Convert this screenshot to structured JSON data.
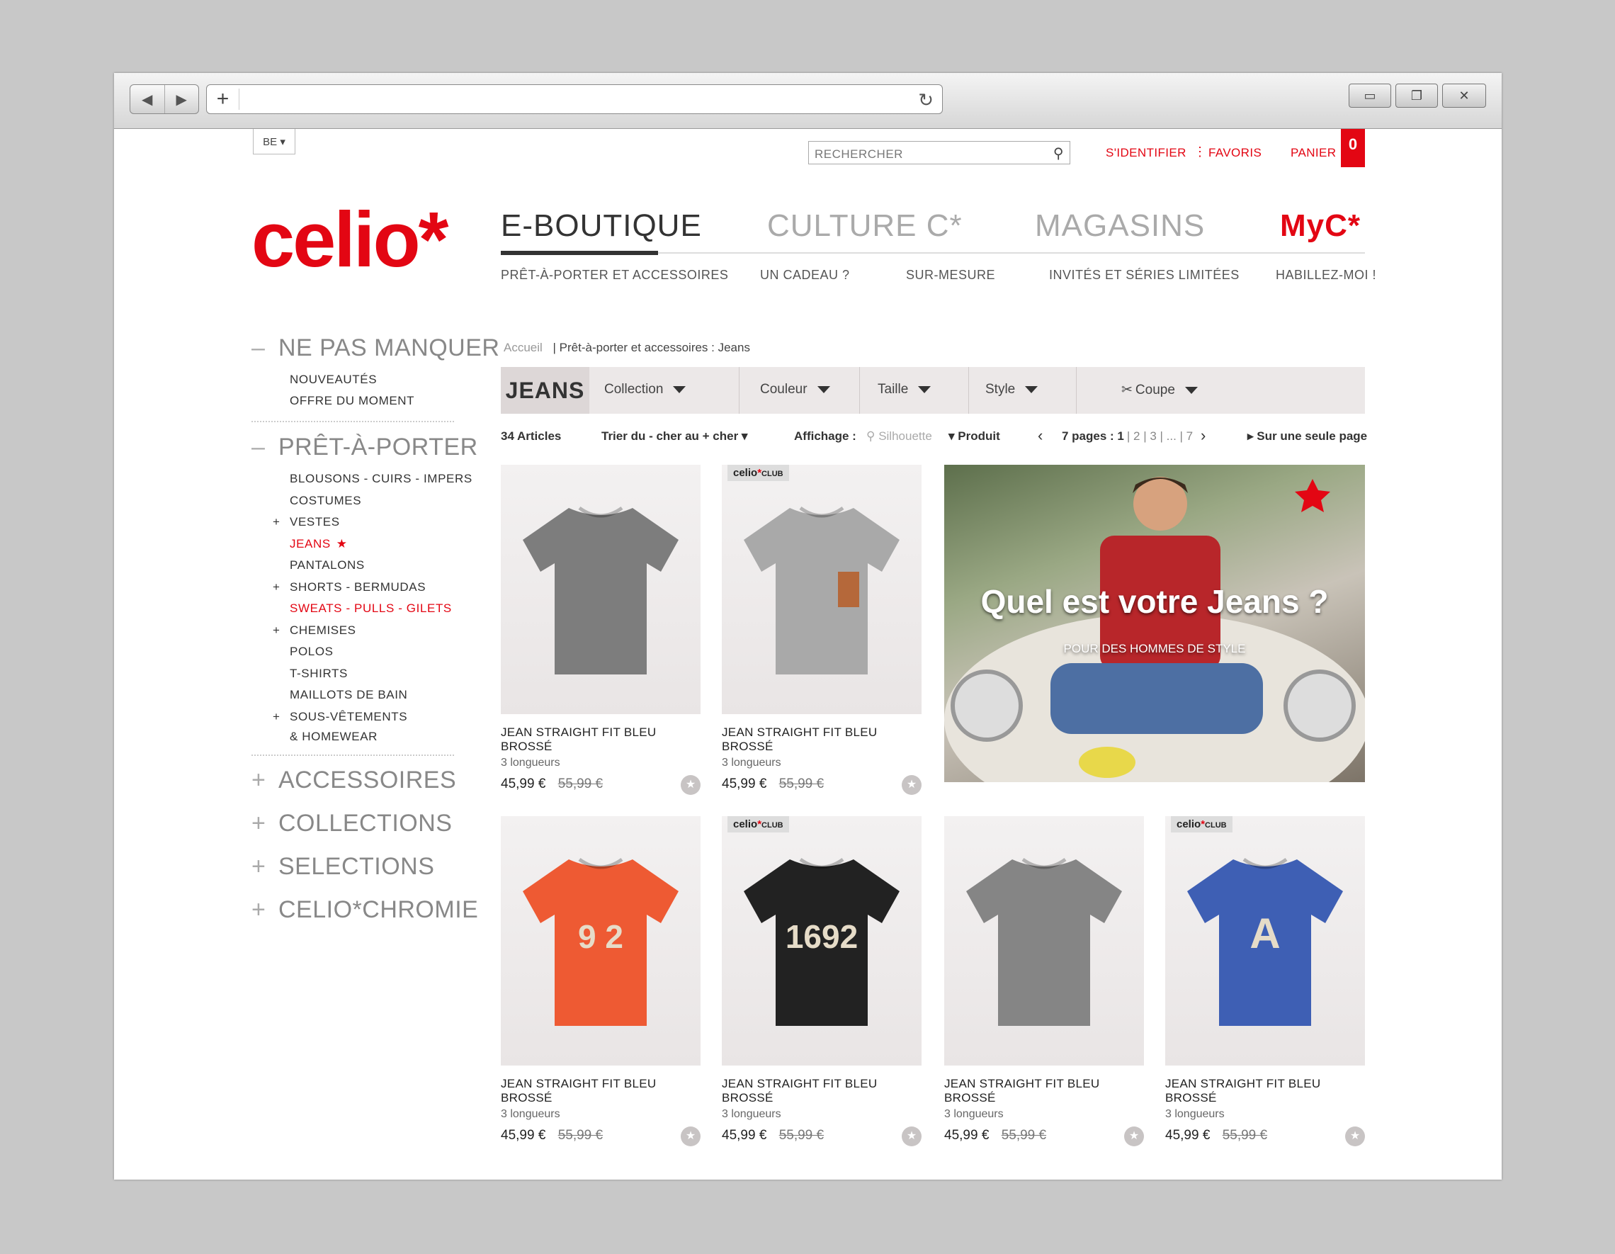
{
  "browser": {
    "back": "◀",
    "forward": "▶",
    "new_tab": "+",
    "reload": "↻",
    "minimize": "▭",
    "restore": "❐",
    "close": "✕"
  },
  "top": {
    "lang": "BE ▾",
    "search_placeholder": "RECHERCHER",
    "login": "S'IDENTIFIER",
    "favorites": "FAVORIS",
    "cart": "PANIER",
    "cart_count": "0"
  },
  "logo": "celio*",
  "main_nav": [
    {
      "label": "E-BOUTIQUE"
    },
    {
      "label": "CULTURE C*"
    },
    {
      "label": "MAGASINS"
    },
    {
      "label": "MyC*"
    }
  ],
  "sub_nav": [
    {
      "label": "PRÊT-À-PORTER ET ACCESSOIRES"
    },
    {
      "label": "UN CADEAU ?"
    },
    {
      "label": "SUR-MESURE"
    },
    {
      "label": "INVITÉS ET SÉRIES LIMITÉES"
    },
    {
      "label": "HABILLEZ-MOI !"
    }
  ],
  "sidebar": {
    "ne_pas_manquer": {
      "sign": "–",
      "label": "NE PAS MANQUER",
      "items": [
        "NOUVEAUTÉS",
        "OFFRE DU MOMENT"
      ]
    },
    "pret": {
      "sign": "–",
      "label": "PRÊT-À-PORTER",
      "items": [
        {
          "label": "BLOUSONS - CUIRS - IMPERS",
          "plus": ""
        },
        {
          "label": "COSTUMES",
          "plus": ""
        },
        {
          "label": "VESTES",
          "plus": "+"
        },
        {
          "label": "JEANS",
          "plus": "",
          "star": "★"
        },
        {
          "label": "PANTALONS",
          "plus": ""
        },
        {
          "label": "SHORTS - BERMUDAS",
          "plus": "+"
        },
        {
          "label": "SWEATS - PULLS - GILETS",
          "plus": ""
        },
        {
          "label": "CHEMISES",
          "plus": "+"
        },
        {
          "label": "POLOS",
          "plus": ""
        },
        {
          "label": "T-SHIRTS",
          "plus": ""
        },
        {
          "label": "MAILLOTS DE BAIN",
          "plus": ""
        },
        {
          "label": "SOUS-VÊTEMENTS",
          "plus": "+"
        },
        {
          "label": "& HOMEWEAR",
          "plus": ""
        }
      ]
    },
    "sections": [
      {
        "sign": "+",
        "label": "ACCESSOIRES"
      },
      {
        "sign": "+",
        "label": "COLLECTIONS"
      },
      {
        "sign": "+",
        "label": "SELECTIONS"
      },
      {
        "sign": "+",
        "label": "CELIO*CHROMIE"
      }
    ]
  },
  "breadcrumb": {
    "home": "Accueil",
    "path": "| Prêt-à-porter et accessoires : Jeans"
  },
  "filters": {
    "title": "JEANS",
    "collection": "Collection",
    "couleur": "Couleur",
    "taille": "Taille",
    "style": "Style",
    "coupe": "Coupe"
  },
  "toolbar": {
    "count": "34 Articles",
    "sort": "Trier du - cher au + cher ▾",
    "display_label": "Affichage :",
    "silhouette": "Silhouette",
    "produit": "Produit",
    "pages_label": "7 pages : 1",
    "pages_rest": "| 2 | 3 | ... | 7",
    "single": "▸ Sur une seule page"
  },
  "hero": {
    "title": "Quel est votre Jeans ?",
    "subtitle": "POUR DES HOMMES DE STYLE"
  },
  "club_badge": {
    "brand": "celio",
    "star": "*",
    "club": "CLUB"
  },
  "products": [
    {
      "name": "JEAN STRAIGHT FIT BLEU BROSSÉ",
      "sub": "3 longueurs",
      "price": "45,99 €",
      "old_price": "55,99 €",
      "color": "#7d7d7d",
      "club": false,
      "print": ""
    },
    {
      "name": "JEAN STRAIGHT FIT BLEU BROSSÉ",
      "sub": "3 longueurs",
      "price": "45,99 €",
      "old_price": "55,99 €",
      "color": "#a9a9a9",
      "club": true,
      "print": ""
    },
    {
      "name": "JEAN STRAIGHT FIT BLEU BROSSÉ",
      "sub": "3 longueurs",
      "price": "45,99 €",
      "old_price": "55,99 €",
      "color": "#ee5a33",
      "club": false,
      "print": "9 2"
    },
    {
      "name": "JEAN STRAIGHT FIT BLEU BROSSÉ",
      "sub": "3 longueurs",
      "price": "45,99 €",
      "old_price": "55,99 €",
      "color": "#222222",
      "club": true,
      "print": "1692"
    },
    {
      "name": "JEAN STRAIGHT FIT BLEU BROSSÉ",
      "sub": "3 longueurs",
      "price": "45,99 €",
      "old_price": "55,99 €",
      "color": "#858585",
      "club": false,
      "print": ""
    },
    {
      "name": "JEAN STRAIGHT FIT BLEU BROSSÉ",
      "sub": "3 longueurs",
      "price": "45,99 €",
      "old_price": "55,99 €",
      "color": "#3e5fb4",
      "club": true,
      "print": "A"
    }
  ]
}
